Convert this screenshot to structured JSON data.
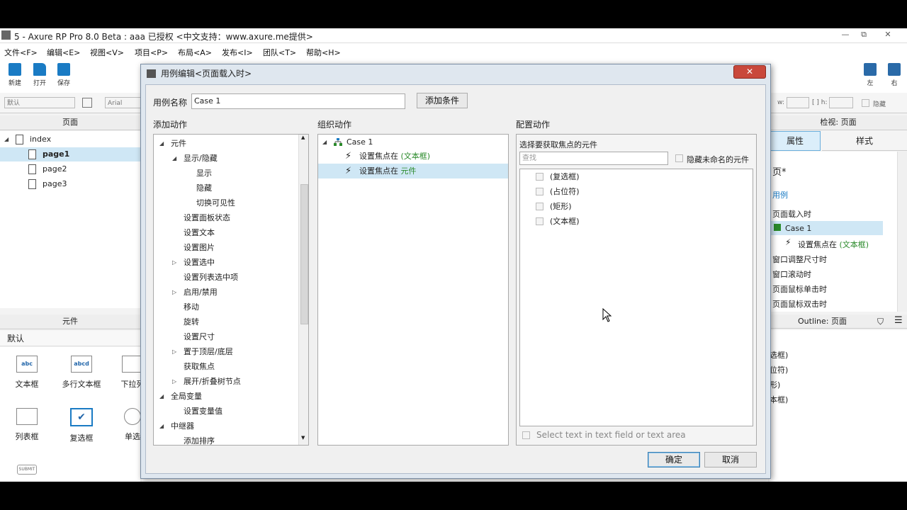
{
  "window": {
    "title": "5 - Axure RP Pro 8.0 Beta : aaa 已授权     <中文支持：www.axure.me提供>",
    "min": "—",
    "max": "⧉",
    "close": "✕"
  },
  "menu": [
    "文件<F>",
    "编辑<E>",
    "视图<V>",
    "项目<P>",
    "布局<A>",
    "发布<I>",
    "团队<T>",
    "帮助<H>"
  ],
  "toolbar": {
    "new": "新建",
    "open": "打开",
    "save": "保存",
    "left": "左",
    "right": "右"
  },
  "stylebar": {
    "style_select": "默认",
    "font_select": "Arial",
    "w_label": "w:",
    "h_label": "[ ] h:",
    "hide_label": "隐藏"
  },
  "pages": {
    "header": "页面",
    "root": "index",
    "items": [
      "page1",
      "page2",
      "page3"
    ]
  },
  "widgets": {
    "header": "元件",
    "library": "默认",
    "items": [
      {
        "label": "文本框",
        "icon": "abc"
      },
      {
        "label": "多行文本框",
        "icon": "abcd"
      },
      {
        "label": "下拉列",
        "icon": ""
      },
      {
        "label": "列表框",
        "icon": ""
      },
      {
        "label": "复选框",
        "icon": "✔"
      },
      {
        "label": "单选",
        "icon": ""
      }
    ],
    "submit": "SUBMIT"
  },
  "inspector": {
    "header": "检视: 页面",
    "tab_props": "属性",
    "tab_style": "样式",
    "page_marker": "页*",
    "cases_label": "用例",
    "rows": [
      "页面载入时",
      "Case 1",
      "设置焦点在",
      "(文本框)",
      "窗口调整尺寸时",
      "窗口滚动时",
      "页面鼠标单击时",
      "页面鼠标双击时"
    ],
    "outline_header": "Outline: 页面",
    "outline": [
      "选框)",
      "位符)",
      "形)",
      "本框)"
    ]
  },
  "dialog": {
    "title": "用例编辑<页面载入时>",
    "close": "✕",
    "case_name_label": "用例名称",
    "case_name_value": "Case 1",
    "add_condition": "添加条件",
    "col1_title": "添加动作",
    "col2_title": "组织动作",
    "col3_title": "配置动作",
    "actions": [
      {
        "label": "元件",
        "level": 0,
        "toggle": "open"
      },
      {
        "label": "显示/隐藏",
        "level": 1,
        "toggle": "open"
      },
      {
        "label": "显示",
        "level": 2,
        "toggle": ""
      },
      {
        "label": "隐藏",
        "level": 2,
        "toggle": ""
      },
      {
        "label": "切换可见性",
        "level": 2,
        "toggle": ""
      },
      {
        "label": "设置面板状态",
        "level": 1,
        "toggle": ""
      },
      {
        "label": "设置文本",
        "level": 1,
        "toggle": ""
      },
      {
        "label": "设置图片",
        "level": 1,
        "toggle": ""
      },
      {
        "label": "设置选中",
        "level": 1,
        "toggle": "closed"
      },
      {
        "label": "设置列表选中项",
        "level": 1,
        "toggle": ""
      },
      {
        "label": "启用/禁用",
        "level": 1,
        "toggle": "closed"
      },
      {
        "label": "移动",
        "level": 1,
        "toggle": ""
      },
      {
        "label": "旋转",
        "level": 1,
        "toggle": ""
      },
      {
        "label": "设置尺寸",
        "level": 1,
        "toggle": ""
      },
      {
        "label": "置于顶层/底层",
        "level": 1,
        "toggle": "closed"
      },
      {
        "label": "获取焦点",
        "level": 1,
        "toggle": ""
      },
      {
        "label": "展开/折叠树节点",
        "level": 1,
        "toggle": "closed"
      },
      {
        "label": "全局变量",
        "level": 0,
        "toggle": "open"
      },
      {
        "label": "设置变量值",
        "level": 1,
        "toggle": ""
      },
      {
        "label": "中继器",
        "level": 0,
        "toggle": "open"
      },
      {
        "label": "添加排序",
        "level": 1,
        "toggle": ""
      }
    ],
    "organize": {
      "case_label": "Case 1",
      "steps": [
        {
          "prefix": "设置焦点在 ",
          "target": "(文本框)"
        },
        {
          "prefix": "设置焦点在 ",
          "target": "元件"
        }
      ]
    },
    "configure": {
      "heading": "选择要获取焦点的元件",
      "search_placeholder": "查找",
      "hide_unnamed": "隐藏未命名的元件",
      "elements": [
        "(复选框)",
        "(占位符)",
        "(矩形)",
        "(文本框)"
      ],
      "select_text": "Select text in text field or text area"
    },
    "ok": "确定",
    "cancel": "取消"
  },
  "colors": {
    "accent_blue": "#1a7bc4",
    "selected_row": "#cfe7f5",
    "green_link": "#2a8a2a",
    "close_red": "#c9483b"
  }
}
